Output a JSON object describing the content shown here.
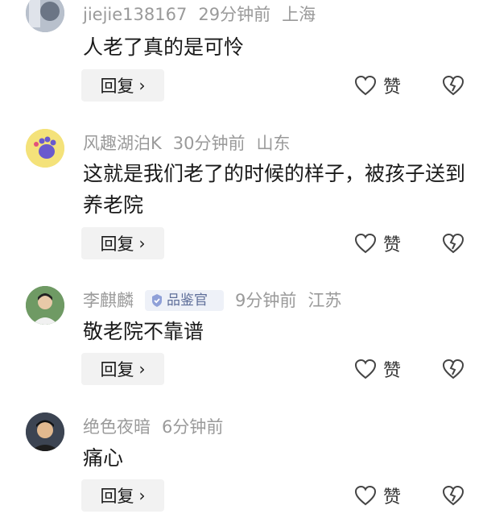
{
  "comments": [
    {
      "username": "jiejie138167",
      "time": "29分钟前",
      "location": "上海",
      "badge": "",
      "text": "人老了真的是可怜",
      "reply_label": "回复",
      "like_label": "赞",
      "avatar_color": "#9aa4b5"
    },
    {
      "username": "风趣湖泊K",
      "time": "30分钟前",
      "location": "山东",
      "badge": "",
      "text": "这就是我们老了的时候的样子，被孩子送到养老院",
      "reply_label": "回复",
      "like_label": "赞",
      "avatar_color": "#f4e27a"
    },
    {
      "username": "李麒麟",
      "time": "9分钟前",
      "location": "江苏",
      "badge": "品鉴官",
      "text": "敬老院不靠谱",
      "reply_label": "回复",
      "like_label": "赞",
      "avatar_color": "#5e8a5a"
    },
    {
      "username": "绝色夜暗",
      "time": "6分钟前",
      "location": "",
      "badge": "",
      "text": "痛心",
      "reply_label": "回复",
      "like_label": "赞",
      "avatar_color": "#4d5a6b"
    }
  ]
}
